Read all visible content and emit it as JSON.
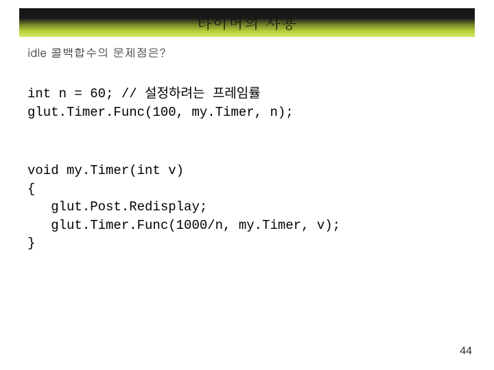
{
  "title": "타이머의 사용",
  "subheading": "idle 콜백합수의 문제점은?",
  "code1": "int n = 60; // 설정하려는 프레임률\nglut.Timer.Func(100, my.Timer, n);",
  "code2": "void my.Timer(int v)\n{\n   glut.Post.Redisplay;\n   glut.Timer.Func(1000/n, my.Timer, v);\n}",
  "pageNumber": "44"
}
